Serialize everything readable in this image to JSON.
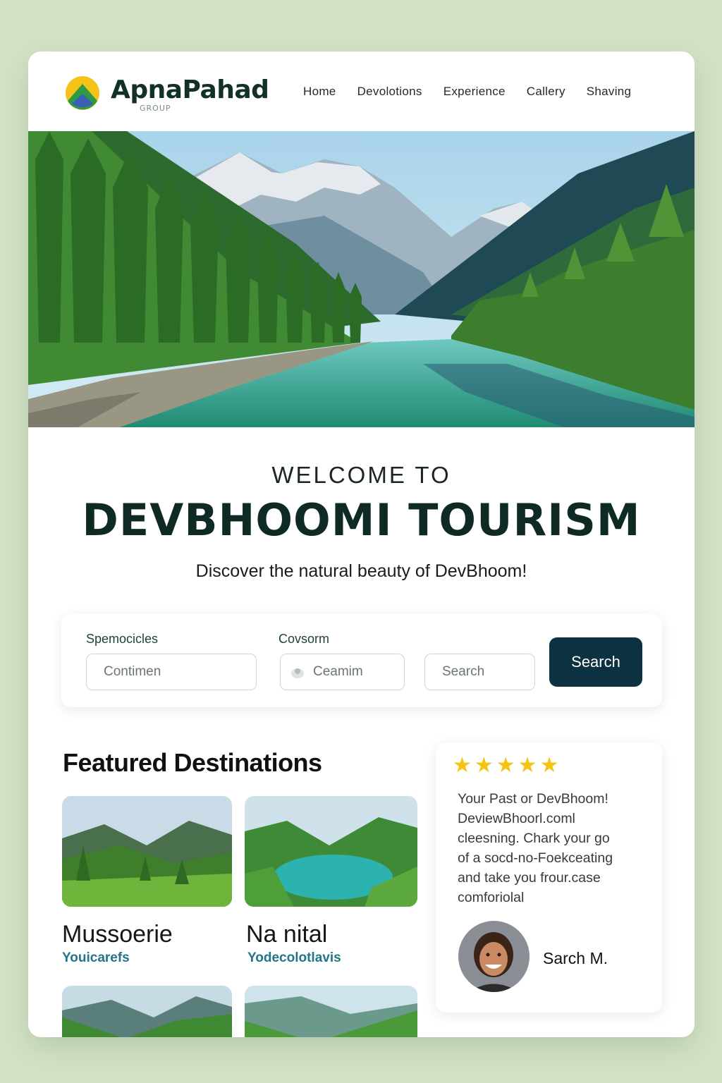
{
  "brand": {
    "name": "ApnaPahad",
    "tagline": "GROUP"
  },
  "nav": {
    "items": [
      "Home",
      "Devolotions",
      "Experience",
      "Callery",
      "Shaving"
    ]
  },
  "welcome": {
    "pre": "WELCOME TO",
    "title": "DEVBHOOMI TOURISM",
    "subtitle": "Discover the natural beauty of DevBhoom!"
  },
  "search": {
    "field1_label": "Spemocicles",
    "field1_placeholder": "Contimen",
    "field2_label": "Covsorm",
    "field2_placeholder": "Ceamim",
    "field3_placeholder": "Search",
    "button_label": "Search"
  },
  "featured": {
    "title": "Featured Destinations",
    "destinations": [
      {
        "name": "Mussoerie",
        "tag": "Youicarefs"
      },
      {
        "name": "Na nital",
        "tag": "Yodecolotlavis"
      }
    ]
  },
  "review": {
    "rating": 5,
    "stars": "★★★★★",
    "lines": [
      "Your Past or DevBhoom!",
      "DeviewBhoorl.coml",
      "cleesning. Chark your go",
      "of a socd-no-Foekceating",
      "and take you frour.case",
      "comforiolal"
    ],
    "reviewer": "Sarch M."
  },
  "colors": {
    "background": "#d3e2c6",
    "primary_button": "#0c3242",
    "star": "#f5c313",
    "tag": "#24748a"
  }
}
